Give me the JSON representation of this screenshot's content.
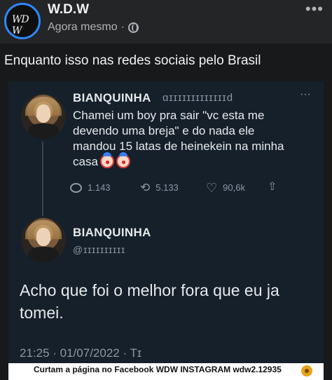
{
  "post": {
    "author": "W.D.W",
    "time": "Agora mesmo",
    "separator": "·",
    "more": "•••",
    "caption": "Enquanto isso nas redes sociais pelo Brasil"
  },
  "tweet1": {
    "name": "BIANQUINHA",
    "handle": "ɑɪɪɪɪɪɪɪɪɪɪɪɪɪd",
    "more": "···",
    "text": "Chamei um boy pra sair \"vc esta me\ndevendo uma breja\" e do nada ele\nmandou 15 latas de heinekein na minha\ncasa",
    "replies": "1.143",
    "retweets": "5.133",
    "likes": "90,6k"
  },
  "tweet2": {
    "name": "BIANQUINHA",
    "handle": "@ɪɪɪɪɪɪɪɪɪɪ",
    "text": "Acho que foi o melhor fora que eu ja\ntomei.",
    "timestamp": "21:25 · 01/07/2022 · Tɪ"
  },
  "footer": {
    "text": "Curtam a página no Facebook WDW INSTAGRAM wdw2.12935"
  },
  "icons": [
    "globe-icon",
    "clown-icon",
    "reply-icon",
    "retweet-icon",
    "heart-icon",
    "share-icon",
    "camera-icon"
  ],
  "colors": {
    "page_bg": "#18191a",
    "tweet_bg": "#15202b",
    "accent_ring": "#2d88ff",
    "muted": "#8b98a5"
  }
}
